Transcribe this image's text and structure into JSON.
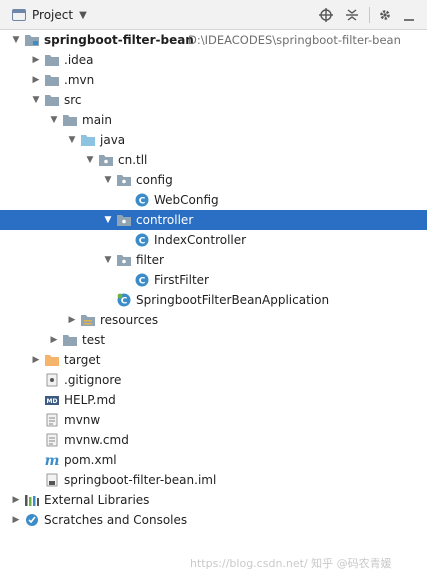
{
  "header": {
    "title": "Project",
    "dropdown_glyph": "▼"
  },
  "tree": [
    {
      "label": "springboot-filter-bean",
      "path": "D:\\IDEACODES\\springboot-filter-bean",
      "expanded": true,
      "icon": "module-folder-icon"
    },
    {
      "label": ".idea",
      "expanded": false,
      "icon": "folder-icon"
    },
    {
      "label": ".mvn",
      "expanded": false,
      "icon": "folder-icon"
    },
    {
      "label": "src",
      "expanded": true,
      "icon": "folder-icon"
    },
    {
      "label": "main",
      "expanded": true,
      "icon": "folder-icon"
    },
    {
      "label": "java",
      "expanded": true,
      "icon": "source-folder-icon"
    },
    {
      "label": "cn.tll",
      "expanded": true,
      "icon": "package-icon"
    },
    {
      "label": "config",
      "expanded": true,
      "icon": "package-icon"
    },
    {
      "label": "WebConfig",
      "icon": "class-icon"
    },
    {
      "label": "controller",
      "expanded": true,
      "icon": "package-icon",
      "selected": true
    },
    {
      "label": "IndexController",
      "icon": "class-icon"
    },
    {
      "label": "filter",
      "expanded": true,
      "icon": "package-icon"
    },
    {
      "label": "FirstFilter",
      "icon": "class-icon"
    },
    {
      "label": "SpringbootFilterBeanApplication",
      "icon": "spring-class-icon"
    },
    {
      "label": "resources",
      "expanded": false,
      "icon": "resources-folder-icon"
    },
    {
      "label": "test",
      "expanded": false,
      "icon": "folder-icon"
    },
    {
      "label": "target",
      "expanded": false,
      "icon": "excluded-folder-icon"
    },
    {
      "label": ".gitignore",
      "icon": "gitignore-file-icon"
    },
    {
      "label": "HELP.md",
      "icon": "markdown-file-icon"
    },
    {
      "label": "mvnw",
      "icon": "text-file-icon"
    },
    {
      "label": "mvnw.cmd",
      "icon": "text-file-icon"
    },
    {
      "label": "pom.xml",
      "icon": "maven-file-icon"
    },
    {
      "label": "springboot-filter-bean.iml",
      "icon": "iml-file-icon"
    },
    {
      "label": "External Libraries",
      "expanded": false,
      "icon": "libraries-icon"
    },
    {
      "label": "Scratches and Consoles",
      "expanded": false,
      "icon": "scratches-icon"
    }
  ],
  "watermark": "https://blog.csdn.net/  知乎 @码农青媛",
  "colors": {
    "selection": "#2a6fc3",
    "folder": "#90a4b4",
    "source_folder": "#8cc3e0",
    "excluded_folder": "#f4b46a",
    "class": "#3a8dc9"
  }
}
